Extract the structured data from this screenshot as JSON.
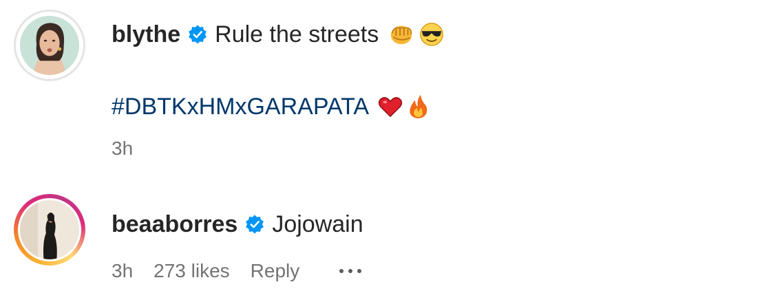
{
  "comments": [
    {
      "username": "blythe",
      "verified": true,
      "text": "Rule the streets",
      "emojis": [
        "fist-emoji",
        "sunglasses-emoji"
      ],
      "hashtag": "#DBTKxHMxGARAPATA",
      "hashtag_emojis": [
        "red-heart-emoji",
        "fire-emoji"
      ],
      "time": "3h"
    },
    {
      "username": "beaaborres",
      "verified": true,
      "text": "Jojowain",
      "time": "3h",
      "likes": "273 likes",
      "reply_label": "Reply",
      "more_icon": "more-options-icon"
    }
  ],
  "colors": {
    "verified": "#0095f6",
    "hashtag": "#00376b",
    "meta": "#737373",
    "text": "#262626"
  }
}
